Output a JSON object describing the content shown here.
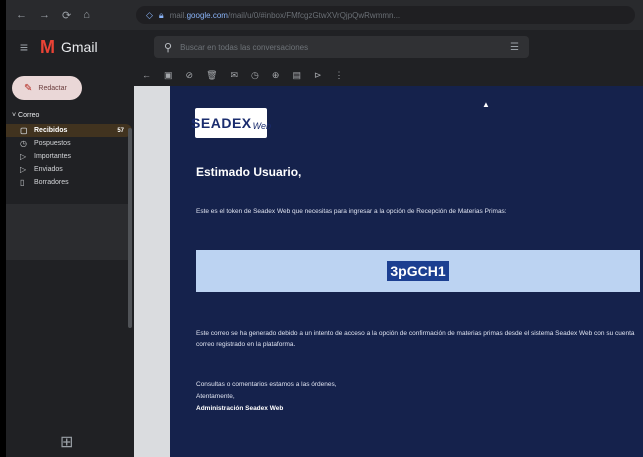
{
  "browser": {
    "nav": [
      "←",
      "→",
      "⟳",
      "⌂"
    ],
    "url_prefix": "mail.",
    "url_domain": "google.com",
    "url_rest": "/mail/u/0/#inbox/FMfcgzGtwXVrQjpQwRwmmn..."
  },
  "gmail": {
    "app_name": "Gmail",
    "search_placeholder": "Buscar en todas las conversaciones"
  },
  "sidebar": {
    "compose_label": "Redactar",
    "section_label": "Correo",
    "items": [
      {
        "label": "Recibidos",
        "count": "57"
      },
      {
        "label": "Pospuestos",
        "count": ""
      },
      {
        "label": "Importantes",
        "count": ""
      },
      {
        "label": "Enviados",
        "count": ""
      },
      {
        "label": "Borradores",
        "count": ""
      }
    ]
  },
  "email": {
    "logo_main": "SEADEX",
    "logo_sub": "Web",
    "greeting": "Estimado Usuario,",
    "paragraph1": "Este es el token de Seadex Web que necesitas para ingresar a la opción de Recepción de Materias Primas:",
    "token": "3pGCH1",
    "paragraph2": "Este correo se ha generado debido a un intento de acceso a la opción de confirmación de materias primas desde el sistema Seadex Web con su cuenta correo registrado en la plataforma.",
    "contact_line": "Consultas o comentarios estamos a las órdenes,",
    "closing": "Atentamente,",
    "signature": "Administración Seadex Web"
  },
  "colors": {
    "email_bg": "#15224c",
    "token_box": "#bcd3f2",
    "token_highlight": "#1c3f91",
    "active_item_bg": "#41331f"
  }
}
